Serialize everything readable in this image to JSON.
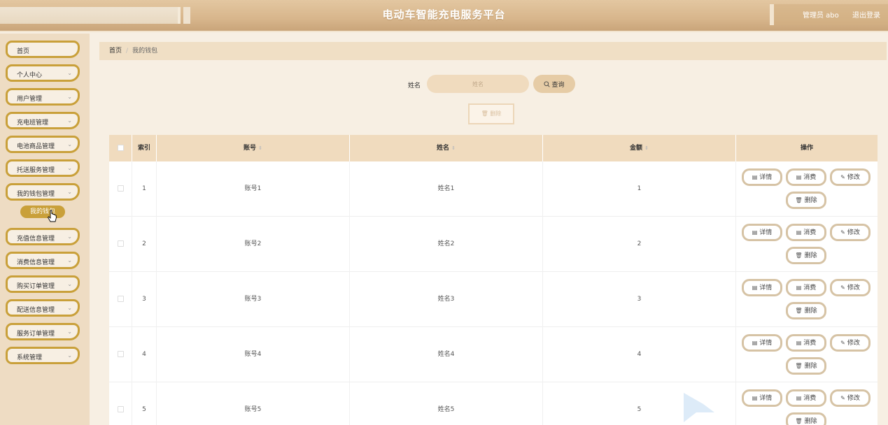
{
  "header": {
    "title": "电动车智能充电服务平台",
    "user": "管理员 abo",
    "logout": "退出登录"
  },
  "sidebar": {
    "items": [
      {
        "label": "首页",
        "chevron": ""
      },
      {
        "label": "个人中心",
        "chevron": "⌄"
      },
      {
        "label": "用户管理",
        "chevron": "⌄"
      },
      {
        "label": "充电班管理",
        "chevron": "⌄"
      },
      {
        "label": "电池商品管理",
        "chevron": "⌄"
      },
      {
        "label": "托送服务管理",
        "chevron": "⌄"
      },
      {
        "label": "我的钱包管理",
        "chevron": "⌄"
      },
      {
        "label": "充值信息管理",
        "chevron": "⌄"
      },
      {
        "label": "消费信息管理",
        "chevron": "⌄"
      },
      {
        "label": "购买订单管理",
        "chevron": "⌄"
      },
      {
        "label": "配送信息管理",
        "chevron": "⌄"
      },
      {
        "label": "服务订单管理",
        "chevron": "⌄"
      },
      {
        "label": "系统管理",
        "chevron": "⌄"
      }
    ],
    "sub_active": "我的钱包"
  },
  "breadcrumb": {
    "home": "首页",
    "sep": "/",
    "current": "我的钱包"
  },
  "search": {
    "label": "姓名",
    "placeholder": "姓名",
    "button": "查询"
  },
  "batch_delete": "删除",
  "table": {
    "headers": {
      "index": "索引",
      "account": "账号",
      "name": "姓名",
      "amount": "金额",
      "actions": "操作"
    },
    "sort_icon": "⇕",
    "rows": [
      {
        "index": "1",
        "account": "账号1",
        "name": "姓名1",
        "amount": "1"
      },
      {
        "index": "2",
        "account": "账号2",
        "name": "姓名2",
        "amount": "2"
      },
      {
        "index": "3",
        "account": "账号3",
        "name": "姓名3",
        "amount": "3"
      },
      {
        "index": "4",
        "account": "账号4",
        "name": "姓名4",
        "amount": "4"
      },
      {
        "index": "5",
        "account": "账号5",
        "name": "姓名5",
        "amount": "5"
      }
    ],
    "actions": {
      "detail": "详情",
      "consume": "消费",
      "edit": "修改",
      "delete": "删除"
    }
  },
  "icons": {
    "search": "search-icon",
    "delete": "trash-icon",
    "detail": "document-icon",
    "consume": "receipt-icon",
    "edit": "pencil-icon"
  },
  "colors": {
    "accent": "#c9a03a",
    "header": "#d8b68c",
    "table_head": "#f0dbbe"
  }
}
